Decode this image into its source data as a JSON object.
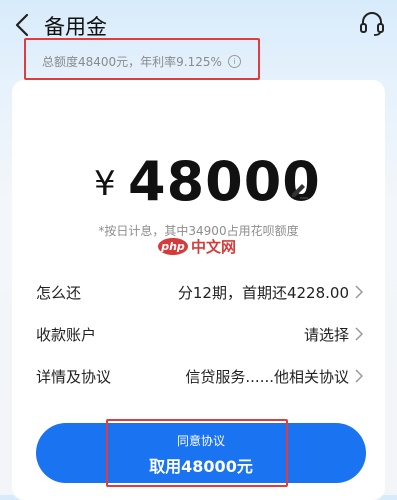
{
  "header": {
    "title": "备用金",
    "back_icon": "chevron-left-icon",
    "service_icon": "headset-icon"
  },
  "subinfo": {
    "text": "总额度48400元，年利率9.125%",
    "info_icon_glyph": "i"
  },
  "amount": {
    "currency": "¥",
    "value": "48000",
    "edit_icon": "pencil-icon"
  },
  "note": "*按日计息，其中34900占用花呗额度",
  "watermark": {
    "logo": "php",
    "text": "中文网"
  },
  "rows": [
    {
      "label": "怎么还",
      "value": "分12期，首期还4228.00"
    },
    {
      "label": "收款账户",
      "value": "请选择"
    },
    {
      "label": "详情及协议",
      "value": "信贷服务......他相关协议"
    }
  ],
  "button": {
    "sub": "同意协议",
    "main": "取用48000元",
    "color": "#1a73f0"
  },
  "highlight_color": "#e23b3b"
}
